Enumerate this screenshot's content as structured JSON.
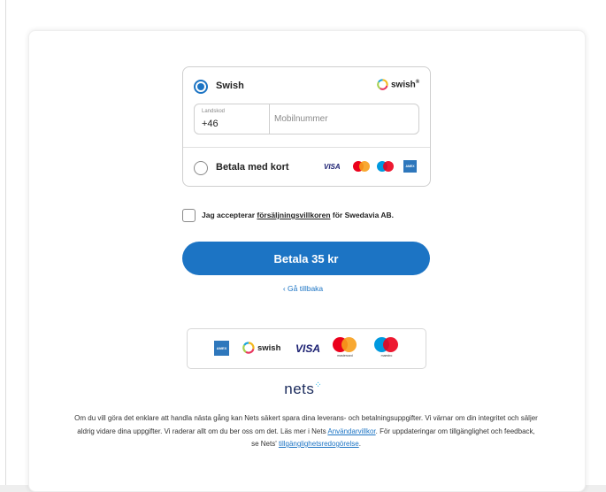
{
  "payment": {
    "swish_label": "Swish",
    "swish_logo_text": "swish",
    "swish_logo_sup": "®",
    "country_code_label": "Landskod",
    "country_code_value": "+46",
    "phone_placeholder": "Mobilnummer",
    "card_label": "Betala med kort",
    "visa_text": "VISA",
    "amex_text": "AMEX",
    "selected": "swish"
  },
  "terms": {
    "prefix": "Jag accepterar ",
    "link": "försäljningsvillkoren",
    "suffix": " för Swedavia AB.",
    "checked": false
  },
  "pay_button_label": "Betala 35 kr",
  "back_link": "‹ Gå tillbaka",
  "logos": {
    "amex_text": "AMEX",
    "swish_text": "swish",
    "visa_text": "VISA",
    "mastercard_text": "mastercard",
    "maestro_text": "maestro"
  },
  "brand": "nets",
  "footer": {
    "text1": "Om du vill göra det enklare att handla nästa gång kan Nets säkert spara dina leverans- och betalningsuppgifter. Vi värnar om din integritet och säljer aldrig vidare dina uppgifter. Vi raderar allt om du ber oss om det. Läs mer i Nets ",
    "link1": "Användarvillkor",
    "text2": ". För uppdateringar om tillgänglighet och feedback, se Nets' ",
    "link2": "tillgänglighetsredogörelse",
    "text3": "."
  },
  "colors": {
    "primary": "#1c74c4",
    "mastercard_red": "#eb001b",
    "mastercard_yellow": "#f79e1b",
    "maestro_blue": "#0099df",
    "amex_blue": "#2e77bc",
    "visa_blue": "#1a1f71"
  }
}
